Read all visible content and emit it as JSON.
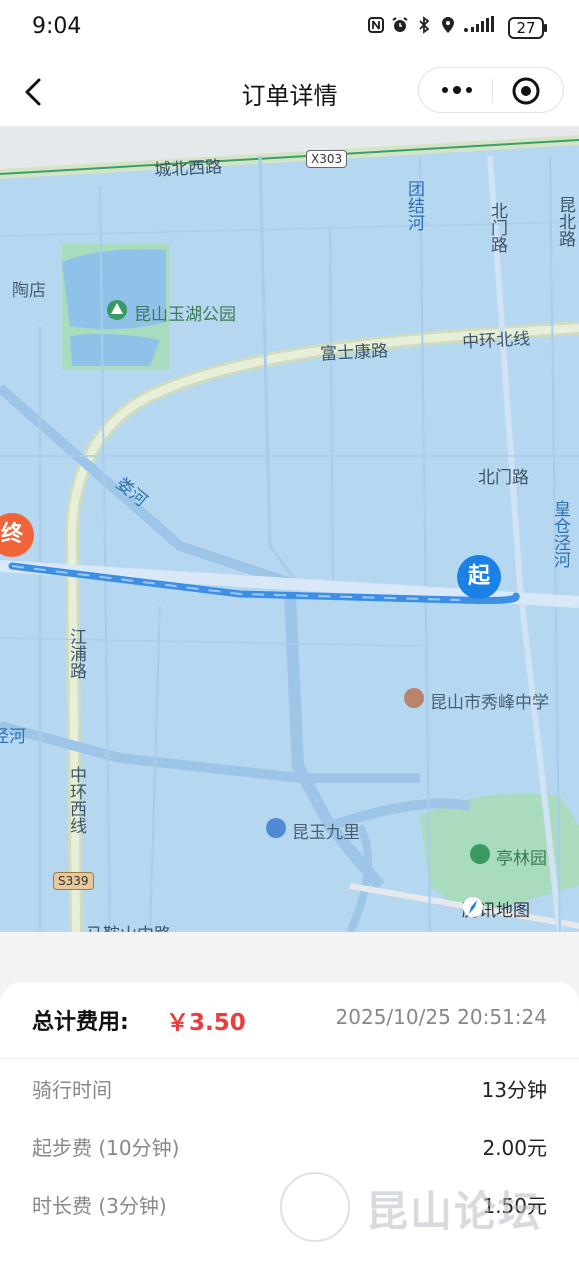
{
  "status_bar": {
    "time": "9:04",
    "battery": "27",
    "icons": [
      "nfc-icon",
      "alarm-icon",
      "bluetooth-icon",
      "location-icon",
      "signal-icon",
      "battery-icon"
    ]
  },
  "nav": {
    "title": "订单详情",
    "back_icon": "chevron-left-icon",
    "more_icon": "ellipsis-icon",
    "target_icon": "target-icon"
  },
  "map": {
    "roads": {
      "north_west": "城北西路",
      "highway": "X303",
      "fushikang": "富士康路",
      "zhonghuan_north": "中环北线",
      "beimen": "北门路",
      "beimen_v": "北门路",
      "kunbei": "昆北路",
      "jiangpu": "江浦路",
      "zhonghuan_west": "中环西线",
      "provincial": "S339",
      "maanshan": "马鞍山中路"
    },
    "rivers": {
      "tuanjie": "团结河",
      "xiao": "娄河",
      "huangcang": "皇仓泾河",
      "jing": "泾河"
    },
    "places": {
      "taodian": "陶店",
      "yuhu_park": "昆山玉湖公园",
      "xiufeng_school": "昆山市秀峰中学",
      "kunyu": "昆玉九里",
      "tinglin": "亭林园"
    },
    "start_pin": "起",
    "end_pin": "终",
    "brand": "腾讯地图",
    "colors": {
      "water": "#b6d7f0",
      "route": "#3d8fe6",
      "start": "#1a82e6",
      "end": "#f1643a",
      "park": "#a9dcbe"
    }
  },
  "order": {
    "total_label": "总计费用:",
    "total_amount": "￥3.50",
    "datetime": "2025/10/25 20:51:24",
    "rows": [
      {
        "label": "骑行时间",
        "value": "13分钟"
      },
      {
        "label": "起步费 (10分钟)",
        "value": "2.00元"
      },
      {
        "label": "时长费 (3分钟)",
        "value": "1.50元"
      }
    ],
    "accent": "#ee3b3b"
  },
  "watermark": {
    "text": "昆山论坛"
  }
}
